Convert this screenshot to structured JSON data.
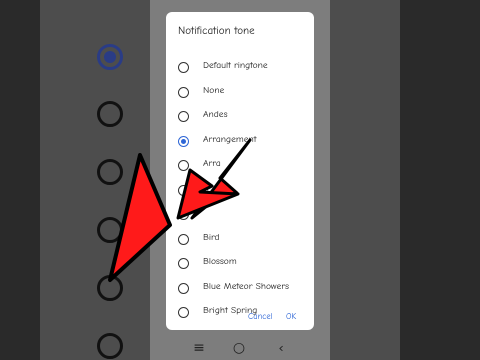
{
  "dialog": {
    "title": "Notification tone",
    "options": [
      {
        "label": "Default ringtone",
        "selected": false
      },
      {
        "label": "None",
        "selected": false
      },
      {
        "label": "Andes",
        "selected": false
      },
      {
        "label": "Arrangement",
        "selected": true
      },
      {
        "label": "Arra",
        "selected": false
      },
      {
        "label": "A",
        "selected": false
      },
      {
        "label": "",
        "selected": false
      },
      {
        "label": "Bird",
        "selected": false
      },
      {
        "label": "Blossom",
        "selected": false
      },
      {
        "label": "Blue Meteor Showers",
        "selected": false
      },
      {
        "label": "Bright Spring",
        "selected": false
      }
    ],
    "buttons": {
      "cancel": "Cancel",
      "ok": "OK"
    }
  },
  "navbar": {
    "icons": [
      "menu-icon",
      "home-icon",
      "back-icon"
    ]
  },
  "colors": {
    "accent": "#2e66d6",
    "arrow_red": "#ff0000",
    "background_dark": "#2a2a2a",
    "phone_gray": "#7d7d7d"
  }
}
